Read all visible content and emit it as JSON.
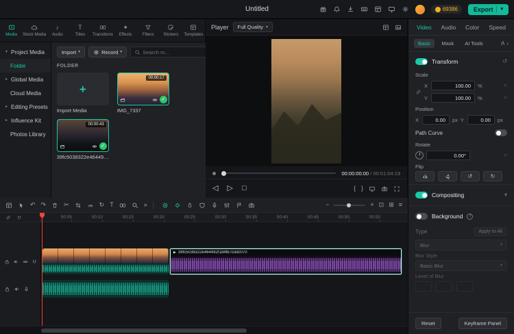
{
  "colors": {
    "accent": "#1cc8a8",
    "export-bg": "#12b99a",
    "check-green": "#2ec56b",
    "coin-yellow": "#f2b21c",
    "playhead-red": "#f4433a",
    "wave-purple": "#b168e6"
  },
  "topbar": {
    "title": "Untitled",
    "coins": "69386",
    "export_label": "Export"
  },
  "media_tabs": [
    "Media",
    "Stock Media",
    "Audio",
    "Titles",
    "Transitions",
    "Effects",
    "Filters",
    "Stickers",
    "Templates"
  ],
  "sidebar": [
    "Project Media",
    "Folder",
    "Global Media",
    "Cloud Media",
    "Editing Presets",
    "Influence Kit",
    "Photos Library"
  ],
  "library": {
    "import": "Import",
    "record": "Record",
    "search_placeholder": "Search m...",
    "section": "FOLDER",
    "import_tile": "Import Media",
    "clip1_name": "IMG_7337",
    "clip1_duration": "00:00:17",
    "clip2_name": "39fc5038322e464492f1d4f...",
    "clip2_duration": "00:00:43"
  },
  "player": {
    "title": "Player",
    "quality": "Full Quality",
    "current": "00:00:00:00",
    "total": "/ 00:01:04:19"
  },
  "props": {
    "tabs": [
      "Video",
      "Audio",
      "Color",
      "Speed"
    ],
    "subtabs": [
      "Basic",
      "Mask",
      "AI Tools",
      "A"
    ],
    "transform": "Transform",
    "scale": "Scale",
    "x": "X",
    "y": "Y",
    "scale_x": "100.00",
    "scale_y": "100.00",
    "pct": "%",
    "position": "Position",
    "pos_x": "0.00",
    "pos_y": "0.00",
    "px": "px",
    "path_curve": "Path Curve",
    "rotate": "Rotate",
    "rotate_val": "0.00°",
    "flip": "Flip",
    "compositing": "Compositing",
    "background": "Background",
    "type": "Type",
    "apply_all": "Apply to All",
    "blur": "Blur",
    "blur_style": "Blur Style",
    "basic_blur": "Basic Blur",
    "level": "Level of Blur",
    "reset": "Reset",
    "keyframe_panel": "Keyframe Panel"
  },
  "timeline": {
    "ruler": [
      "00:05",
      "00:10",
      "00:15",
      "00:20",
      "00:25",
      "00:30",
      "00:35",
      "00:40",
      "00:45",
      "00:50",
      "00:55"
    ],
    "clip_name": "39fc5038322e464492f1d4fb7codc070"
  },
  "glyphs": {
    "chev_down": "▾",
    "chev_right": "▸",
    "chev_r": "›",
    "plus": "+",
    "minus": "−",
    "check": "✓",
    "undo": "↶",
    "redo": "↷",
    "more": "»",
    "scissors": "✂",
    "text": "T",
    "star": "✦",
    "note": "♪",
    "play": "▷",
    "play_solid": "▶",
    "stop": "□",
    "prev": "◁",
    "brace_l": "{",
    "brace_r": "}",
    "rot_l": "↺",
    "rot_r": "↻",
    "circle": "○",
    "question": "?",
    "fit": "⊡",
    "box_plus": "⊞",
    "list": "≡",
    "grid": "▦",
    "dot": "●"
  }
}
